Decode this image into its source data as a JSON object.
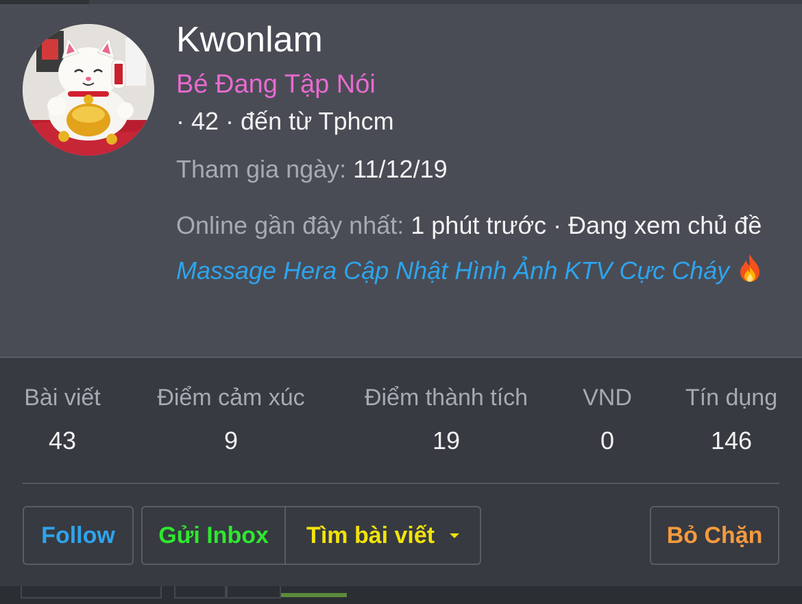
{
  "profile": {
    "username": "Kwonlam",
    "title": "Bé Đang Tập Nói",
    "info": "· 42 · đến từ Tphcm",
    "joined_label": "Tham gia ngày:",
    "joined_value": "11/12/19",
    "online_label": "Online gần đây nhất:",
    "online_value": "1 phút trước · Đang xem chủ đề",
    "thread_title": "Massage Hera Cập Nhật Hình Ảnh KTV Cực Cháy",
    "thread_icon": "fire-icon",
    "avatar_icon": "lucky-cat-avatar"
  },
  "stats": [
    {
      "label": "Bài viết",
      "value": "43"
    },
    {
      "label": "Điểm cảm xúc",
      "value": "9"
    },
    {
      "label": "Điểm thành tích",
      "value": "19"
    },
    {
      "label": "VND",
      "value": "0"
    },
    {
      "label": "Tín dụng",
      "value": "146"
    }
  ],
  "actions": {
    "follow": "Follow",
    "inbox": "Gửi Inbox",
    "find_posts": "Tìm bài viết",
    "unblock": "Bỏ Chặn"
  },
  "colors": {
    "card_top": "#494c55",
    "card_bottom": "#373a41",
    "title_pink": "#e86ad0",
    "link_blue": "#2ea4ec",
    "follow_blue": "#2ea4ec",
    "inbox_green": "#2ee82e",
    "find_yellow": "#f2e30a",
    "unblock_orange": "#f59a3d"
  }
}
